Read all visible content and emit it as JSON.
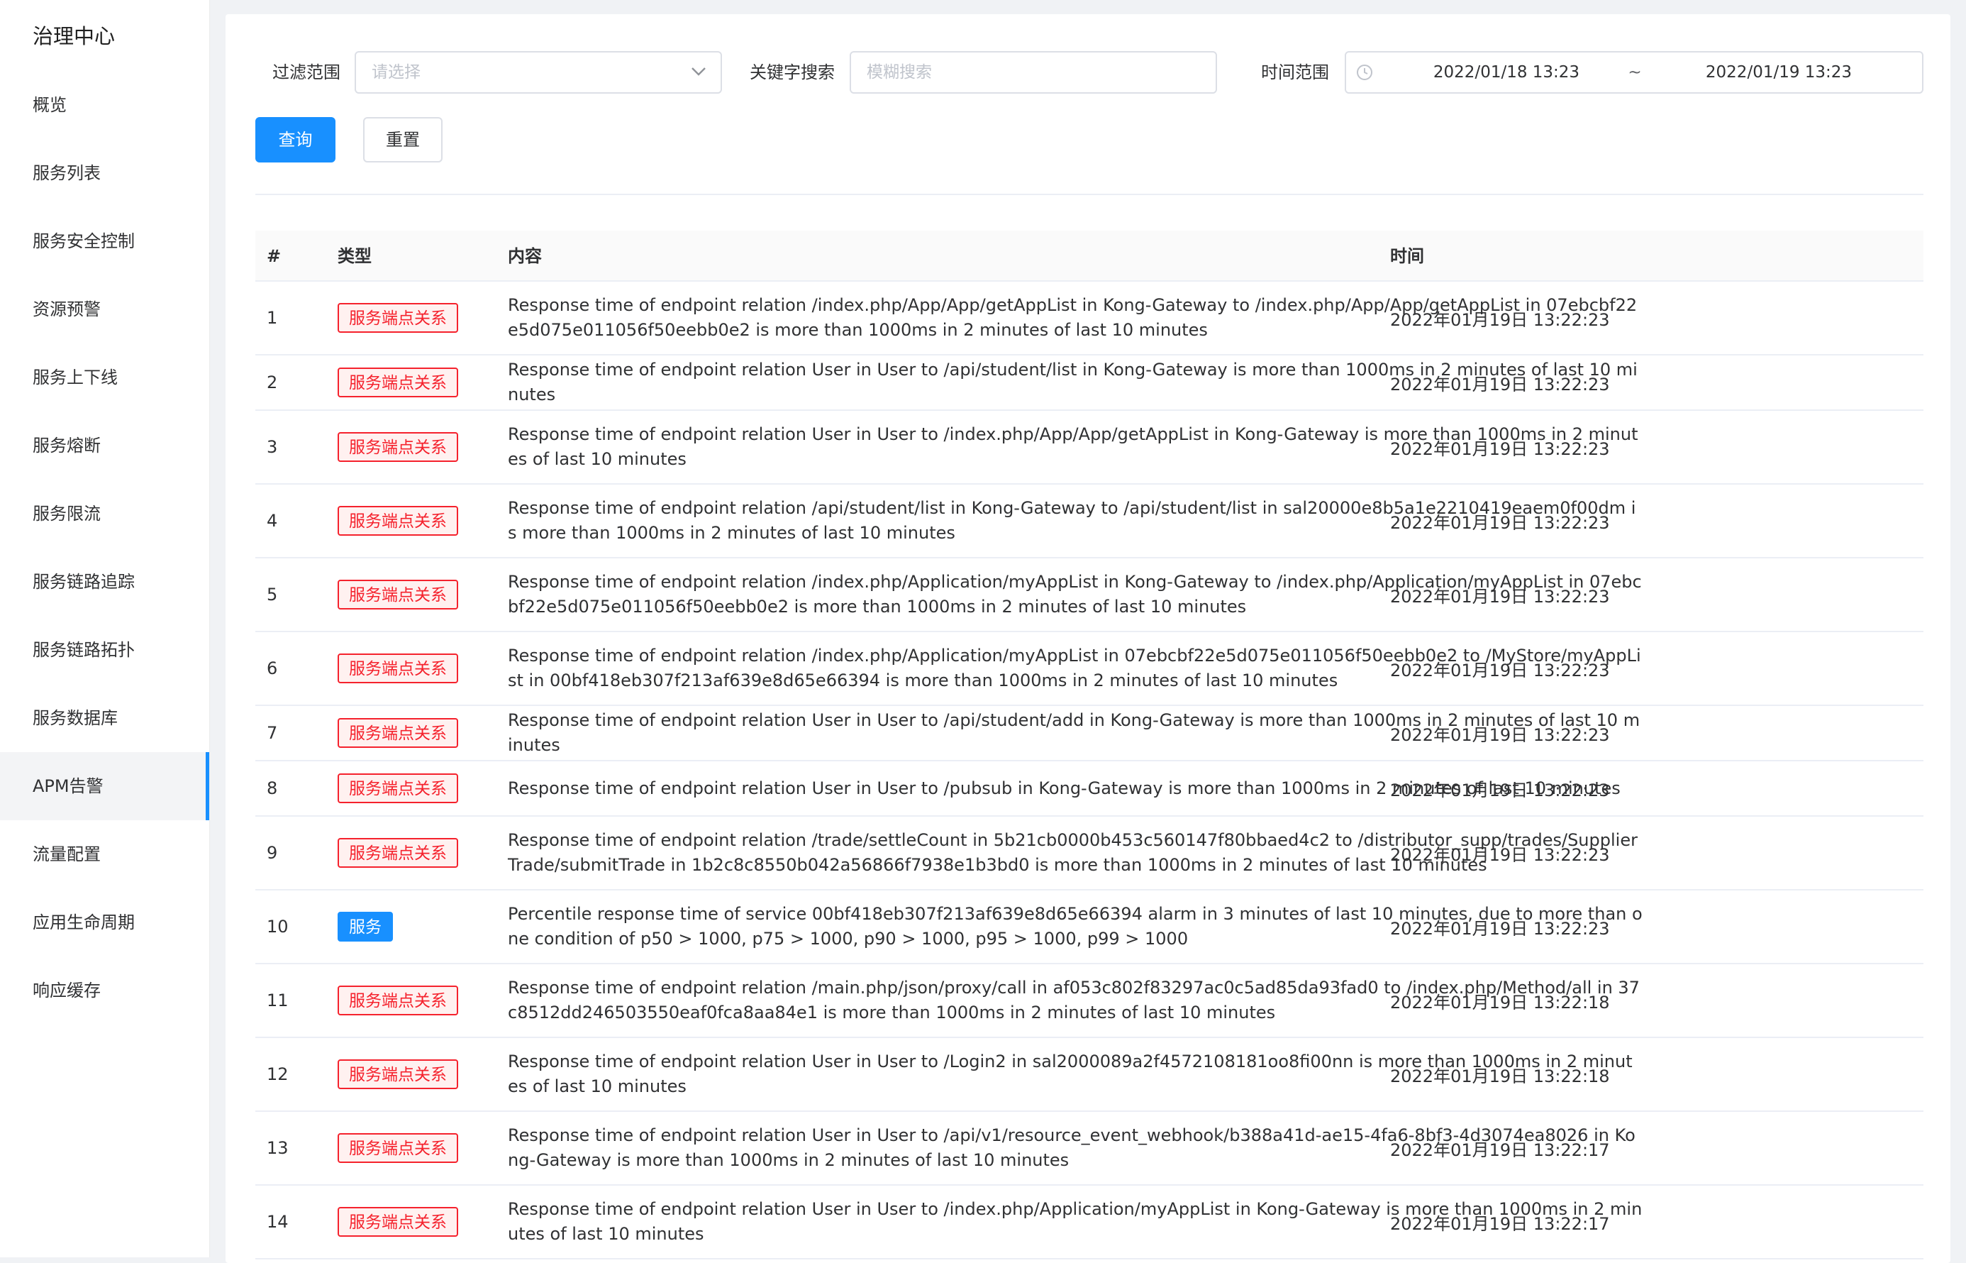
{
  "sidebar": {
    "title": "治理中心",
    "items": [
      {
        "label": "概览",
        "active": false
      },
      {
        "label": "服务列表",
        "active": false
      },
      {
        "label": "服务安全控制",
        "active": false
      },
      {
        "label": "资源预警",
        "active": false
      },
      {
        "label": "服务上下线",
        "active": false
      },
      {
        "label": "服务熔断",
        "active": false
      },
      {
        "label": "服务限流",
        "active": false
      },
      {
        "label": "服务链路追踪",
        "active": false
      },
      {
        "label": "服务链路拓扑",
        "active": false
      },
      {
        "label": "服务数据库",
        "active": false
      },
      {
        "label": "APM告警",
        "active": true
      },
      {
        "label": "流量配置",
        "active": false
      },
      {
        "label": "应用生命周期",
        "active": false
      },
      {
        "label": "响应缓存",
        "active": false
      }
    ]
  },
  "filters": {
    "scope_label": "过滤范围",
    "scope_placeholder": "请选择",
    "keyword_label": "关键字搜索",
    "keyword_placeholder": "模糊搜索",
    "time_label": "时间范围",
    "time_start": "2022/01/18 13:23",
    "time_separator": "~",
    "time_end": "2022/01/19 13:23",
    "query_button": "查询",
    "reset_button": "重置"
  },
  "table": {
    "columns": [
      "#",
      "类型",
      "内容",
      "时间"
    ],
    "rows": [
      {
        "idx": "1",
        "type": "服务端点关系",
        "kind": "relation",
        "lines": 2,
        "content": "Response time of endpoint relation /index.php/App/App/getAppList in Kong-Gateway to /index.php/App/App/getAppList in 07ebcbf22e5d075e011056f50eebb0e2 is more than 1000ms in 2 minutes of last 10 minutes",
        "time": "2022年01月19日 13:22:23"
      },
      {
        "idx": "2",
        "type": "服务端点关系",
        "kind": "relation",
        "lines": 1,
        "content": "Response time of endpoint relation User in User to /api/student/list in Kong-Gateway is more than 1000ms in 2 minutes of last 10 minutes",
        "time": "2022年01月19日 13:22:23"
      },
      {
        "idx": "3",
        "type": "服务端点关系",
        "kind": "relation",
        "lines": 2,
        "content": "Response time of endpoint relation User in User to /index.php/App/App/getAppList in Kong-Gateway is more than 1000ms in 2 minutes of last 10 minutes",
        "time": "2022年01月19日 13:22:23"
      },
      {
        "idx": "4",
        "type": "服务端点关系",
        "kind": "relation",
        "lines": 2,
        "content": "Response time of endpoint relation /api/student/list in Kong-Gateway to /api/student/list in sal20000e8b5a1e2210419eaem0f00dm is more than 1000ms in 2 minutes of last 10 minutes",
        "time": "2022年01月19日 13:22:23"
      },
      {
        "idx": "5",
        "type": "服务端点关系",
        "kind": "relation",
        "lines": 2,
        "content": "Response time of endpoint relation /index.php/Application/myAppList in Kong-Gateway to /index.php/Application/myAppList in 07ebcbf22e5d075e011056f50eebb0e2 is more than 1000ms in 2 minutes of last 10 minutes",
        "time": "2022年01月19日 13:22:23"
      },
      {
        "idx": "6",
        "type": "服务端点关系",
        "kind": "relation",
        "lines": 2,
        "content": "Response time of endpoint relation /index.php/Application/myAppList in 07ebcbf22e5d075e011056f50eebb0e2 to /MyStore/myAppList in 00bf418eb307f213af639e8d65e66394 is more than 1000ms in 2 minutes of last 10 minutes",
        "time": "2022年01月19日 13:22:23"
      },
      {
        "idx": "7",
        "type": "服务端点关系",
        "kind": "relation",
        "lines": 1,
        "content": "Response time of endpoint relation User in User to /api/student/add in Kong-Gateway is more than 1000ms in 2 minutes of last 10 minutes",
        "time": "2022年01月19日 13:22:23"
      },
      {
        "idx": "8",
        "type": "服务端点关系",
        "kind": "relation",
        "lines": 1,
        "content": "Response time of endpoint relation User in User to /pubsub in Kong-Gateway is more than 1000ms in 2 minutes of last 10 minutes",
        "time": "2022年01月19日 13:22:23"
      },
      {
        "idx": "9",
        "type": "服务端点关系",
        "kind": "relation",
        "lines": 2,
        "content": "Response time of endpoint relation /trade/settleCount in 5b21cb0000b453c560147f80bbaed4c2 to /distributor_supp/trades/SupplierTrade/submitTrade in 1b2c8c8550b042a56866f7938e1b3bd0 is more than 1000ms in 2 minutes of last 10 minutes",
        "time": "2022年01月19日 13:22:23"
      },
      {
        "idx": "10",
        "type": "服务",
        "kind": "service",
        "lines": 2,
        "content": "Percentile response time of service 00bf418eb307f213af639e8d65e66394 alarm in 3 minutes of last 10 minutes, due to more than one condition of p50 > 1000, p75 > 1000, p90 > 1000, p95 > 1000, p99 > 1000",
        "time": "2022年01月19日 13:22:23"
      },
      {
        "idx": "11",
        "type": "服务端点关系",
        "kind": "relation",
        "lines": 2,
        "content": "Response time of endpoint relation /main.php/json/proxy/call in af053c802f83297ac0c5ad85da93fad0 to /index.php/Method/all in 37c8512dd246503550eaf0fca8aa84e1 is more than 1000ms in 2 minutes of last 10 minutes",
        "time": "2022年01月19日 13:22:18"
      },
      {
        "idx": "12",
        "type": "服务端点关系",
        "kind": "relation",
        "lines": 2,
        "content": "Response time of endpoint relation User in User to /Login2 in sal2000089a2f4572108181oo8fi00nn is more than 1000ms in 2 minutes of last 10 minutes",
        "time": "2022年01月19日 13:22:18"
      },
      {
        "idx": "13",
        "type": "服务端点关系",
        "kind": "relation",
        "lines": 2,
        "content": "Response time of endpoint relation User in User to /api/v1/resource_event_webhook/b388a41d-ae15-4fa6-8bf3-4d3074ea8026 in Kong-Gateway is more than 1000ms in 2 minutes of last 10 minutes",
        "time": "2022年01月19日 13:22:17"
      },
      {
        "idx": "14",
        "type": "服务端点关系",
        "kind": "relation",
        "lines": 2,
        "content": "Response time of endpoint relation User in User to /index.php/Application/myAppList in Kong-Gateway is more than 1000ms in 2 minutes of last 10 minutes",
        "time": "2022年01月19日 13:22:17"
      }
    ]
  },
  "colors": {
    "primary": "#1890ff",
    "danger": "#f5222d",
    "danger_bg": "#fff1f0",
    "page_bg": "#f0f2f5"
  }
}
